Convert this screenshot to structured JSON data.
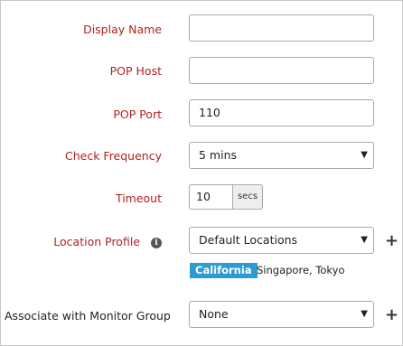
{
  "form": {
    "display_name": {
      "label": "Display Name",
      "value": ""
    },
    "pop_host": {
      "label": "POP Host",
      "value": ""
    },
    "pop_port": {
      "label": "POP Port",
      "value": "110"
    },
    "check_frequency": {
      "label": "Check Frequency",
      "selected": "5 mins"
    },
    "timeout": {
      "label": "Timeout",
      "value": "10",
      "unit": "secs"
    },
    "location_profile": {
      "label": "Location Profile",
      "selected": "Default Locations",
      "highlight_location": "California",
      "other_locations": "Singapore, Tokyo"
    },
    "monitor_group": {
      "label": "Associate with Monitor Group",
      "selected": "None"
    }
  },
  "icons": {
    "info": "info-icon",
    "add": "plus-icon",
    "dropdown": "caret-down-icon"
  },
  "colors": {
    "label_red": "#b22222",
    "tag_blue": "#2b9bd2"
  }
}
